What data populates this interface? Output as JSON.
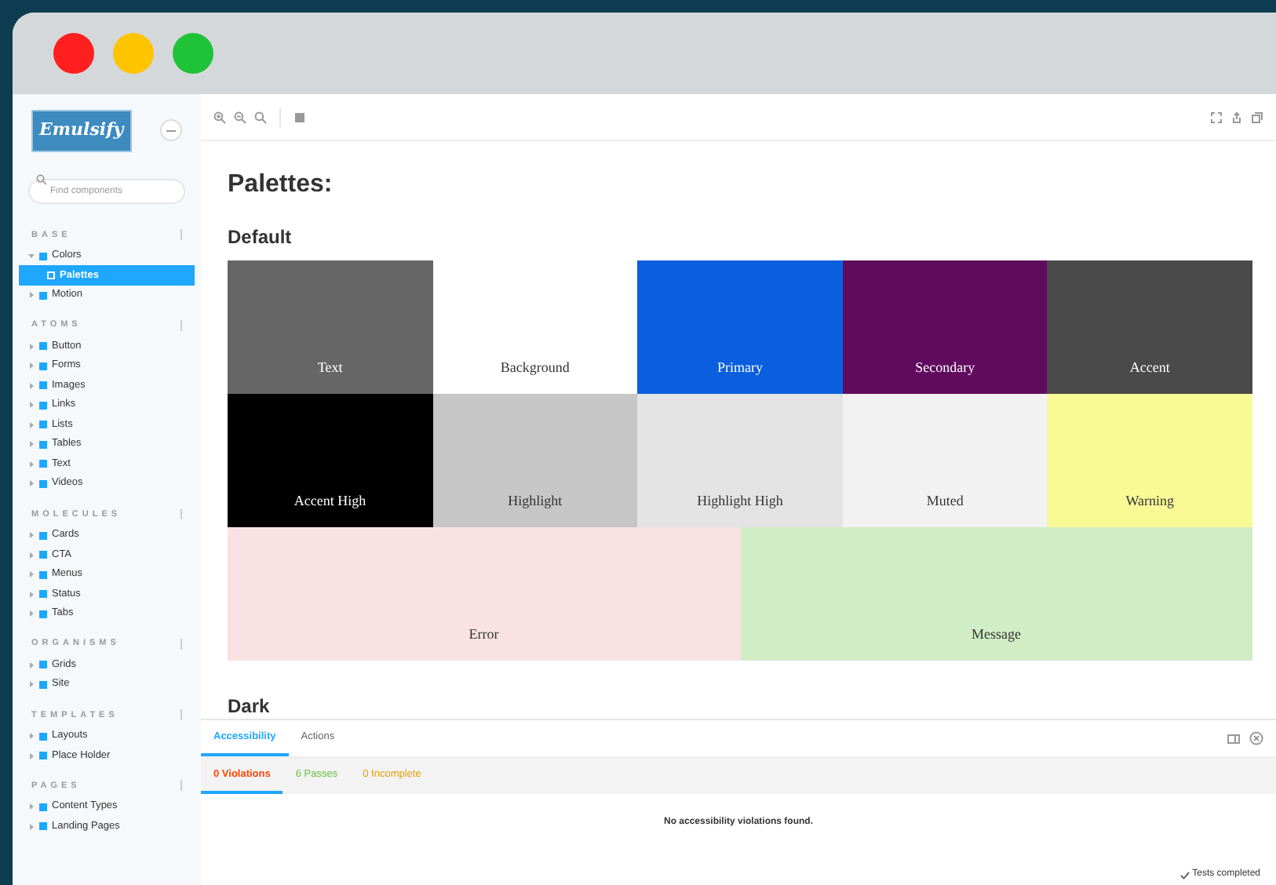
{
  "logo": "Emulsify",
  "search": {
    "placeholder": "Find components"
  },
  "sidebar": [
    {
      "heading": "BASE",
      "items": [
        {
          "label": "Colors",
          "expanded": true,
          "children": [
            {
              "label": "Palettes",
              "selected": true
            }
          ]
        },
        {
          "label": "Motion",
          "expanded": false
        }
      ]
    },
    {
      "heading": "ATOMS",
      "items": [
        {
          "label": "Button",
          "expanded": false
        },
        {
          "label": "Forms",
          "expanded": false
        },
        {
          "label": "Images",
          "expanded": false
        },
        {
          "label": "Links",
          "expanded": false
        },
        {
          "label": "Lists",
          "expanded": false
        },
        {
          "label": "Tables",
          "expanded": false
        },
        {
          "label": "Text",
          "expanded": false
        },
        {
          "label": "Videos",
          "expanded": false
        }
      ]
    },
    {
      "heading": "MOLECULES",
      "items": [
        {
          "label": "Cards",
          "expanded": false
        },
        {
          "label": "CTA",
          "expanded": false
        },
        {
          "label": "Menus",
          "expanded": false
        },
        {
          "label": "Status",
          "expanded": false
        },
        {
          "label": "Tabs",
          "expanded": false
        }
      ]
    },
    {
      "heading": "ORGANISMS",
      "items": [
        {
          "label": "Grids",
          "expanded": false
        },
        {
          "label": "Site",
          "expanded": false
        }
      ]
    },
    {
      "heading": "TEMPLATES",
      "items": [
        {
          "label": "Layouts",
          "expanded": false
        },
        {
          "label": "Place Holder",
          "expanded": false
        }
      ]
    },
    {
      "heading": "PAGES",
      "items": [
        {
          "label": "Content Types",
          "expanded": false
        },
        {
          "label": "Landing Pages",
          "expanded": false
        }
      ]
    }
  ],
  "page_title": "Palettes:",
  "sections": [
    {
      "title": "Default",
      "rows": [
        [
          {
            "label": "Text",
            "color": "#666666"
          },
          {
            "label": "Background",
            "color": "#ffffff"
          },
          {
            "label": "Primary",
            "color": "#0b5fde"
          },
          {
            "label": "Secondary",
            "color": "#610b5f"
          },
          {
            "label": "Accent",
            "color": "#4a4a4a"
          }
        ],
        [
          {
            "label": "Accent High",
            "color": "#000000"
          },
          {
            "label": "Highlight",
            "color": "#c6c6c6"
          },
          {
            "label": "Highlight High",
            "color": "#e3e3e3"
          },
          {
            "label": "Muted",
            "color": "#f2f2f2"
          },
          {
            "label": "Warning",
            "color": "#f9f996"
          }
        ],
        [
          {
            "label": "Error",
            "color": "#f9e2e2"
          },
          {
            "label": "Message",
            "color": "#d0edc5"
          }
        ]
      ]
    },
    {
      "title": "Dark"
    }
  ],
  "addon_tabs": [
    {
      "label": "Accessibility",
      "selected": true
    },
    {
      "label": "Actions",
      "selected": false
    }
  ],
  "result_tabs": [
    {
      "label": "0 Violations",
      "selected": true,
      "color": "#ff4400"
    },
    {
      "label": "6 Passes",
      "selected": false,
      "color": "#66bf3c"
    },
    {
      "label": "0 Incomplete",
      "selected": false,
      "color": "#e69d00"
    }
  ],
  "message": "No accessibility violations found.",
  "status": "Tests completed"
}
